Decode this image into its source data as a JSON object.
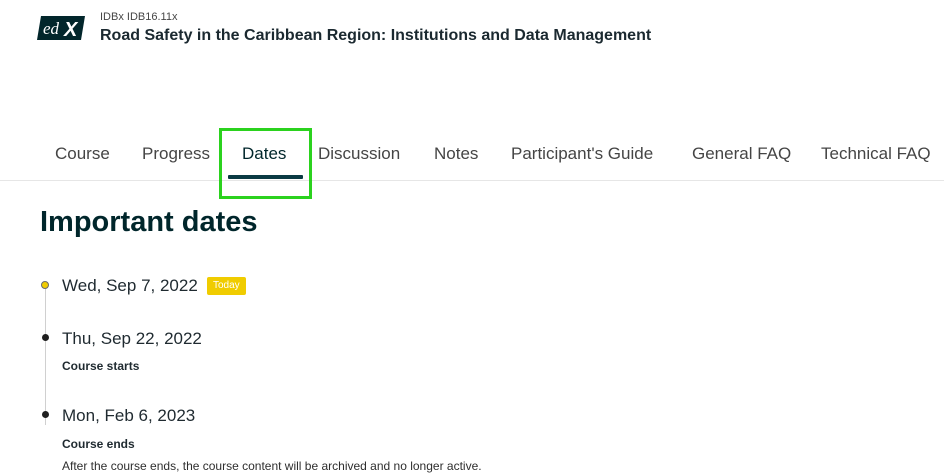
{
  "header": {
    "logo_text": "edX",
    "course_org": "IDBx IDB16.11x",
    "course_title": "Road Safety in the Caribbean Region: Institutions and Data Management"
  },
  "nav": {
    "tabs": [
      {
        "label": "Course"
      },
      {
        "label": "Progress"
      },
      {
        "label": "Dates",
        "active": true
      },
      {
        "label": "Discussion"
      },
      {
        "label": "Notes"
      },
      {
        "label": "Participant's Guide"
      },
      {
        "label": "General FAQ"
      },
      {
        "label": "Technical FAQ"
      }
    ]
  },
  "main": {
    "heading": "Important dates",
    "dates": [
      {
        "date": "Wed, Sep 7, 2022",
        "badge": "Today"
      },
      {
        "date": "Thu, Sep 22, 2022",
        "title": "Course starts"
      },
      {
        "date": "Mon, Feb 6, 2023",
        "title": "Course ends",
        "description": "After the course ends, the course content will be archived and no longer active."
      }
    ]
  },
  "colors": {
    "highlight": "#2bd21e",
    "today_badge": "#f0cc00",
    "active_tab_underline": "#0a3a43",
    "heading": "#00262b"
  }
}
